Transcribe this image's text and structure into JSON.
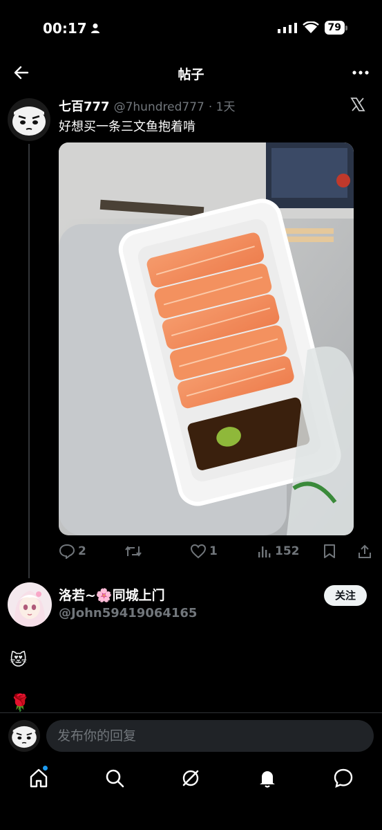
{
  "status_bar": {
    "time": "00:17",
    "battery": "79"
  },
  "topbar": {
    "title": "帖子"
  },
  "post": {
    "author_name": "七百777",
    "author_handle": "@7hundred777",
    "time": "· 1天",
    "text": "好想买一条三文鱼抱着啃",
    "image_description": "Salmon sashimi in a plastic container with soy sauce and wasabi",
    "actions": {
      "replies": "2",
      "likes": "1",
      "views": "152"
    }
  },
  "reply_user": {
    "name": "洛若~🌸同城上门",
    "handle": "@John59419064165",
    "follow_label": "关注"
  },
  "emojis": [
    "😻",
    "🌹"
  ],
  "compose": {
    "placeholder": "发布你的回复"
  },
  "colors": {
    "accent": "#1d9bf0",
    "muted": "#71767b",
    "background": "#000000"
  }
}
